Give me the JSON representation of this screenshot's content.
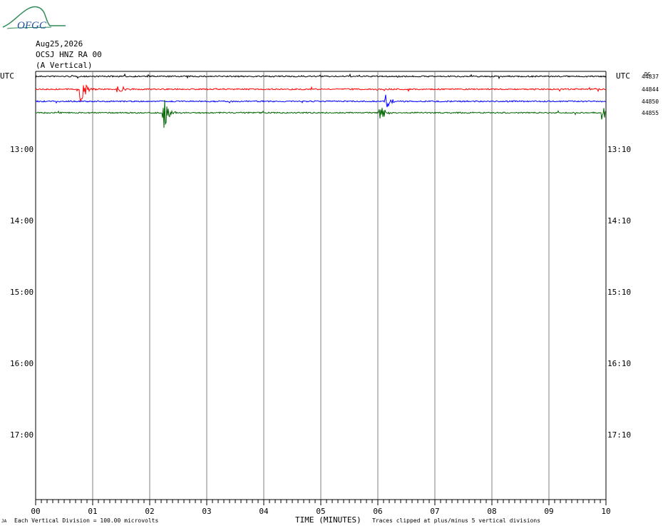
{
  "logo": {
    "text": "OFGC"
  },
  "header": {
    "date": "Aug25,2026",
    "station": "OCSJ HNZ RA 00",
    "component": "(A Vertical)"
  },
  "utc_left": "UTC",
  "utc_right": "UTC",
  "footer": {
    "mark": "JA",
    "division": "Each Vertical Division =  100.00 microvolts",
    "clip": "Traces clipped at plus/minus 5 vertical divisions"
  },
  "colors": {
    "black": "#000000",
    "red": "#ff0000",
    "blue": "#0000ff",
    "green": "#006400",
    "grid": "#808080"
  },
  "chart_data": {
    "type": "line",
    "xlabel": "TIME (MINUTES)",
    "x_ticks": [
      "00",
      "01",
      "02",
      "03",
      "04",
      "05",
      "06",
      "07",
      "08",
      "09",
      "10"
    ],
    "xlim": [
      0,
      10
    ],
    "left_ticks": [
      "13:00",
      "14:00",
      "15:00",
      "16:00",
      "17:00"
    ],
    "right_ticks": [
      "13:10",
      "14:10",
      "15:10",
      "16:10",
      "17:10"
    ],
    "dc_label": "DC",
    "series": [
      {
        "label": "44837",
        "color": "#000000",
        "events": []
      },
      {
        "label": "44844",
        "color": "#ff0000",
        "events": [
          {
            "t": 0.8,
            "amp": 1.0
          },
          {
            "t": 1.45,
            "amp": 0.4
          }
        ]
      },
      {
        "label": "44850",
        "color": "#0000ff",
        "events": [
          {
            "t": 6.15,
            "amp": 0.6
          }
        ]
      },
      {
        "label": "44855",
        "color": "#006400",
        "events": [
          {
            "t": 2.25,
            "amp": 1.0
          },
          {
            "t": 6.05,
            "amp": 0.5
          },
          {
            "t": 9.95,
            "amp": 0.6
          }
        ]
      }
    ]
  }
}
